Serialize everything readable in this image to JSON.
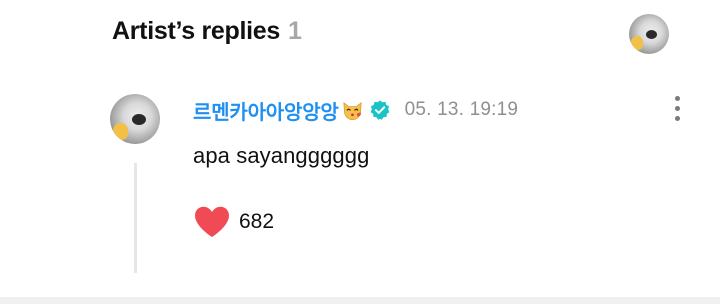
{
  "header": {
    "title": "Artist’s replies",
    "count": "1"
  },
  "comment": {
    "author": "르멘카아아앙앙앙",
    "author_emoji": "cat-kissing-icon",
    "verified": true,
    "timestamp": "05. 13. 19:19",
    "text": "apa sayangggggg",
    "likes": "682"
  },
  "colors": {
    "author_name": "#1f8ff2",
    "verified_badge": "#19c3c8",
    "heart": "#f04b55",
    "timestamp": "#8f8f8f",
    "count": "#a8a8a8"
  }
}
